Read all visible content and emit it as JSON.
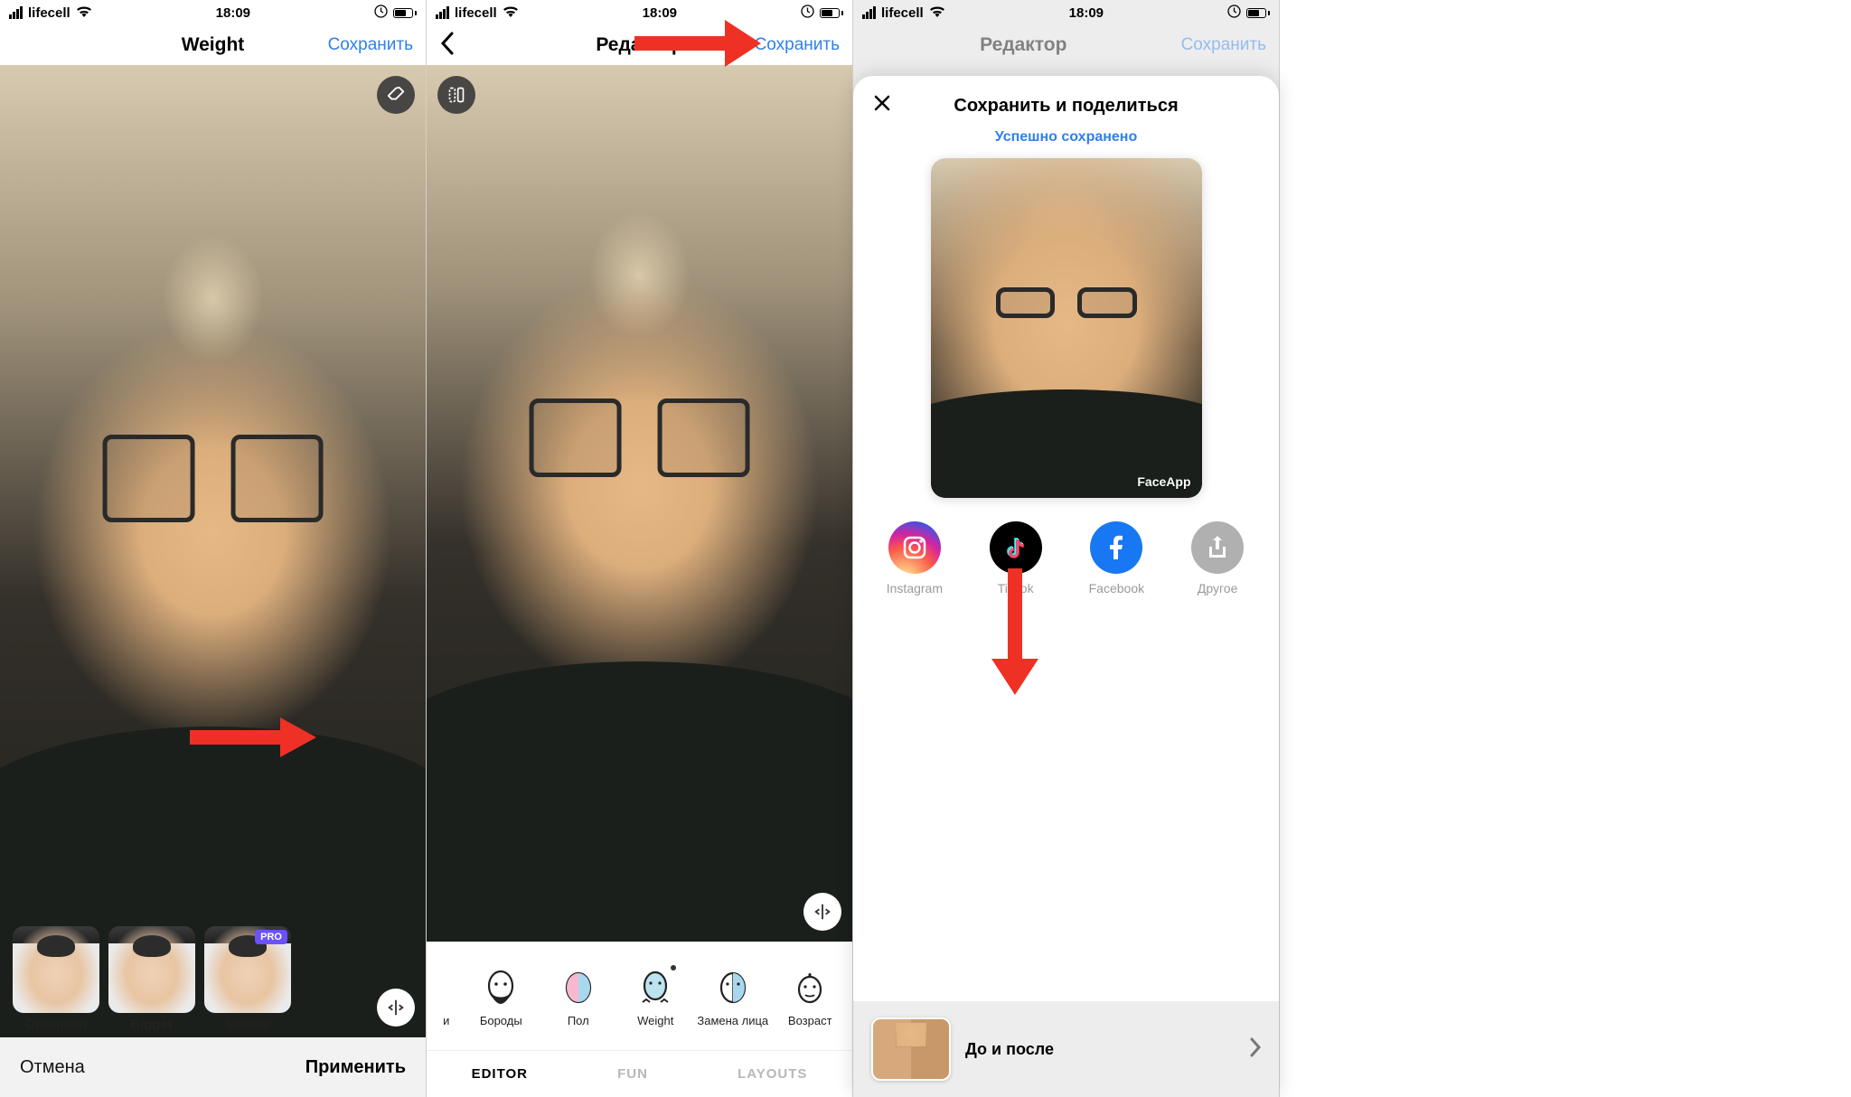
{
  "status_bar": {
    "carrier": "lifecell",
    "time": "18:09"
  },
  "screen1": {
    "title": "Weight",
    "save": "Сохранить",
    "filters": [
      {
        "label": "Оригинал",
        "selected": false,
        "pro": false
      },
      {
        "label": "Bigger",
        "selected": true,
        "pro": false
      },
      {
        "label": "Smaller",
        "selected": false,
        "pro": true
      }
    ],
    "pro_badge": "PRO",
    "cancel": "Отмена",
    "apply": "Применить"
  },
  "screen2": {
    "title": "Редактор",
    "save": "Сохранить",
    "tools": [
      {
        "label": "и"
      },
      {
        "label": "Бороды"
      },
      {
        "label": "Пол"
      },
      {
        "label": "Weight",
        "dot": true
      },
      {
        "label": "Замена лица"
      },
      {
        "label": "Возраст"
      }
    ],
    "tabs": [
      {
        "label": "EDITOR",
        "active": true
      },
      {
        "label": "FUN",
        "active": false
      },
      {
        "label": "LAYOUTS",
        "active": false
      }
    ]
  },
  "screen3": {
    "title_collapsed": "Редактор",
    "save_collapsed": "Сохранить",
    "sheet_title": "Сохранить и поделиться",
    "sheet_subtitle": "Успешно сохранено",
    "watermark": "FaceApp",
    "share": [
      {
        "label": "Instagram",
        "kind": "ig"
      },
      {
        "label": "TikTok",
        "kind": "tt"
      },
      {
        "label": "Facebook",
        "kind": "fb"
      },
      {
        "label": "Другое",
        "kind": "other"
      }
    ],
    "before_after": "До и после"
  }
}
